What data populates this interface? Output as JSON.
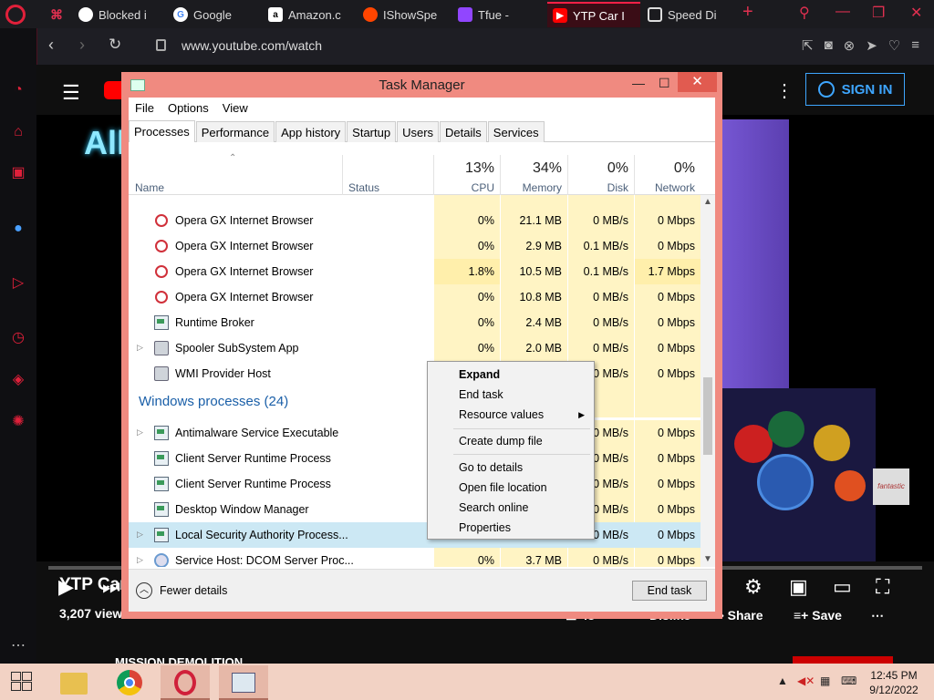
{
  "browser": {
    "tabs": [
      {
        "label": "Blocked i",
        "icon": "blocked-page-icon",
        "color": "#ffffff"
      },
      {
        "label": "Google",
        "icon": "google-icon",
        "color": "#4285f4"
      },
      {
        "label": "Amazon.c",
        "icon": "amazon-icon",
        "color": "#ff9900"
      },
      {
        "label": "IShowSpe",
        "icon": "reddit-icon",
        "color": "#ff4500"
      },
      {
        "label": "Tfue -",
        "icon": "twitch-icon",
        "color": "#9146ff"
      },
      {
        "label": "YTP Car I",
        "icon": "youtube-icon",
        "color": "#ff0000"
      },
      {
        "label": "Speed Di",
        "icon": "speed-dial-icon",
        "color": "#ffffff"
      }
    ],
    "url": "www.youtube.com/watch"
  },
  "youtube": {
    "sign_in": "SIGN IN",
    "overlay_text": "All",
    "video_title": "YTP Car",
    "views": "3,207 view",
    "likes": "48",
    "dislike": "Dislike",
    "share": "Share",
    "save": "Save",
    "channel": "MISSION DEMOLITION",
    "watermark": "fantastic"
  },
  "task_manager": {
    "title": "Task Manager",
    "menu": [
      "File",
      "Options",
      "View"
    ],
    "tabs": [
      "Processes",
      "Performance",
      "App history",
      "Startup",
      "Users",
      "Details",
      "Services"
    ],
    "columns": {
      "name": "Name",
      "status": "Status",
      "cpu_pct": "13%",
      "cpu": "CPU",
      "mem_pct": "34%",
      "mem": "Memory",
      "disk_pct": "0%",
      "disk": "Disk",
      "net_pct": "0%",
      "net": "Network"
    },
    "rows": [
      {
        "name": "Opera GX Internet Browser",
        "cpu": "0%",
        "mem": "21.1 MB",
        "disk": "0 MB/s",
        "net": "0 Mbps"
      },
      {
        "name": "Opera GX Internet Browser",
        "cpu": "0%",
        "mem": "2.9 MB",
        "disk": "0.1 MB/s",
        "net": "0 Mbps"
      },
      {
        "name": "Opera GX Internet Browser",
        "cpu": "1.8%",
        "mem": "10.5 MB",
        "disk": "0.1 MB/s",
        "net": "1.7 Mbps"
      },
      {
        "name": "Opera GX Internet Browser",
        "cpu": "0%",
        "mem": "10.8 MB",
        "disk": "0 MB/s",
        "net": "0 Mbps"
      },
      {
        "name": "Runtime Broker",
        "cpu": "0%",
        "mem": "2.4 MB",
        "disk": "0 MB/s",
        "net": "0 Mbps"
      },
      {
        "name": "Spooler SubSystem App",
        "cpu": "0%",
        "mem": "2.0 MB",
        "disk": "0 MB/s",
        "net": "0 Mbps"
      },
      {
        "name": "WMI Provider Host",
        "cpu": "",
        "mem": "",
        "disk": "0 MB/s",
        "net": "0 Mbps"
      }
    ],
    "group": "Windows processes (24)",
    "win_rows": [
      {
        "name": "Antimalware Service Executable",
        "disk": "0 MB/s",
        "net": "0 Mbps"
      },
      {
        "name": "Client Server Runtime Process",
        "disk": "0 MB/s",
        "net": "0 Mbps"
      },
      {
        "name": "Client Server Runtime Process",
        "disk": "0 MB/s",
        "net": "0 Mbps"
      },
      {
        "name": "Desktop Window Manager",
        "disk": "0 MB/s",
        "net": "0 Mbps"
      },
      {
        "name": "Local Security Authority Process...",
        "disk": "0 MB/s",
        "net": "0 Mbps"
      },
      {
        "name": "Service Host: DCOM Server Proc...",
        "cpu": "0%",
        "mem": "3.7 MB",
        "disk": "0 MB/s",
        "net": "0 Mbps"
      }
    ],
    "fewer_details": "Fewer details",
    "end_task": "End task"
  },
  "context_menu": {
    "items": [
      "Expand",
      "End task",
      "Resource values",
      "Create dump file",
      "Go to details",
      "Open file location",
      "Search online",
      "Properties"
    ]
  },
  "taskbar": {
    "time": "12:45 PM",
    "date": "9/12/2022"
  }
}
